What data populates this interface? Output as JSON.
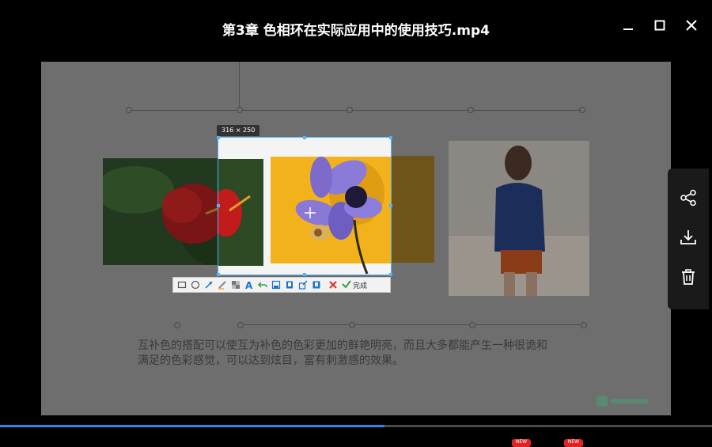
{
  "window": {
    "title": "第3章 色相环在实际应用中的使用技巧.mp4",
    "minimize_icon": "minimize-icon",
    "maximize_icon": "maximize-icon",
    "close_icon": "close-icon"
  },
  "slide": {
    "caption_line1": "互补色的搭配可以使互为补色的色彩更加的鲜艳明亮，而且大多都能产生一种很诡和",
    "caption_line2": "满足的色彩感觉，可以达到炫目，富有刺激感的效果。",
    "watermark_color": "#3cb371"
  },
  "snip": {
    "size_label": "316 × 250",
    "done_label": "完成",
    "tools": [
      "rectangle-icon",
      "ellipse-icon",
      "arrow-icon",
      "pen-icon",
      "mosaic-icon",
      "text-icon",
      "undo-icon",
      "save-icon",
      "copy-icon",
      "share-icon",
      "pin-icon",
      "cancel-icon"
    ],
    "accent": "#4fb3ff"
  },
  "sidebar": {
    "buttons": [
      "share-icon",
      "download-icon",
      "delete-icon"
    ]
  },
  "progress": {
    "played_fraction": 0.54,
    "fill_color": "#1e8cf0"
  },
  "badges": {
    "badge1": "NEW",
    "badge2": "NEW",
    "color": "#e02424"
  }
}
